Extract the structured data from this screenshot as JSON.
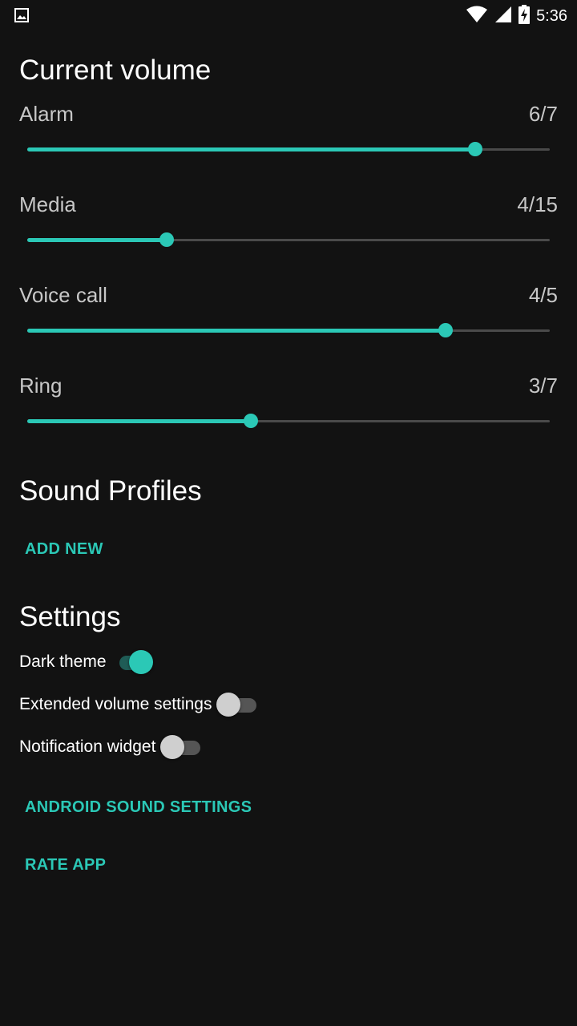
{
  "status_bar": {
    "time": "5:36",
    "icons": [
      "image-notification-icon",
      "wifi-icon",
      "cell-signal-icon",
      "battery-charging-icon"
    ]
  },
  "volume": {
    "title": "Current volume",
    "items": [
      {
        "label": "Alarm",
        "value_text": "6/7",
        "level": 6,
        "max": 7
      },
      {
        "label": "Media",
        "value_text": "4/15",
        "level": 4,
        "max": 15
      },
      {
        "label": "Voice call",
        "value_text": "4/5",
        "level": 4,
        "max": 5
      },
      {
        "label": "Ring",
        "value_text": "3/7",
        "level": 3,
        "max": 7
      }
    ]
  },
  "profiles": {
    "title": "Sound Profiles",
    "add_new": "ADD NEW"
  },
  "settings": {
    "title": "Settings",
    "toggles": [
      {
        "label": "Dark theme",
        "on": true
      },
      {
        "label": "Extended volume settings",
        "on": false
      },
      {
        "label": "Notification widget",
        "on": false
      }
    ],
    "android_sound_settings": "ANDROID SOUND SETTINGS",
    "rate_app": "RATE APP"
  },
  "colors": {
    "accent": "#2bc8b6",
    "background": "#121212",
    "secondary_text": "#c7c7c7"
  }
}
